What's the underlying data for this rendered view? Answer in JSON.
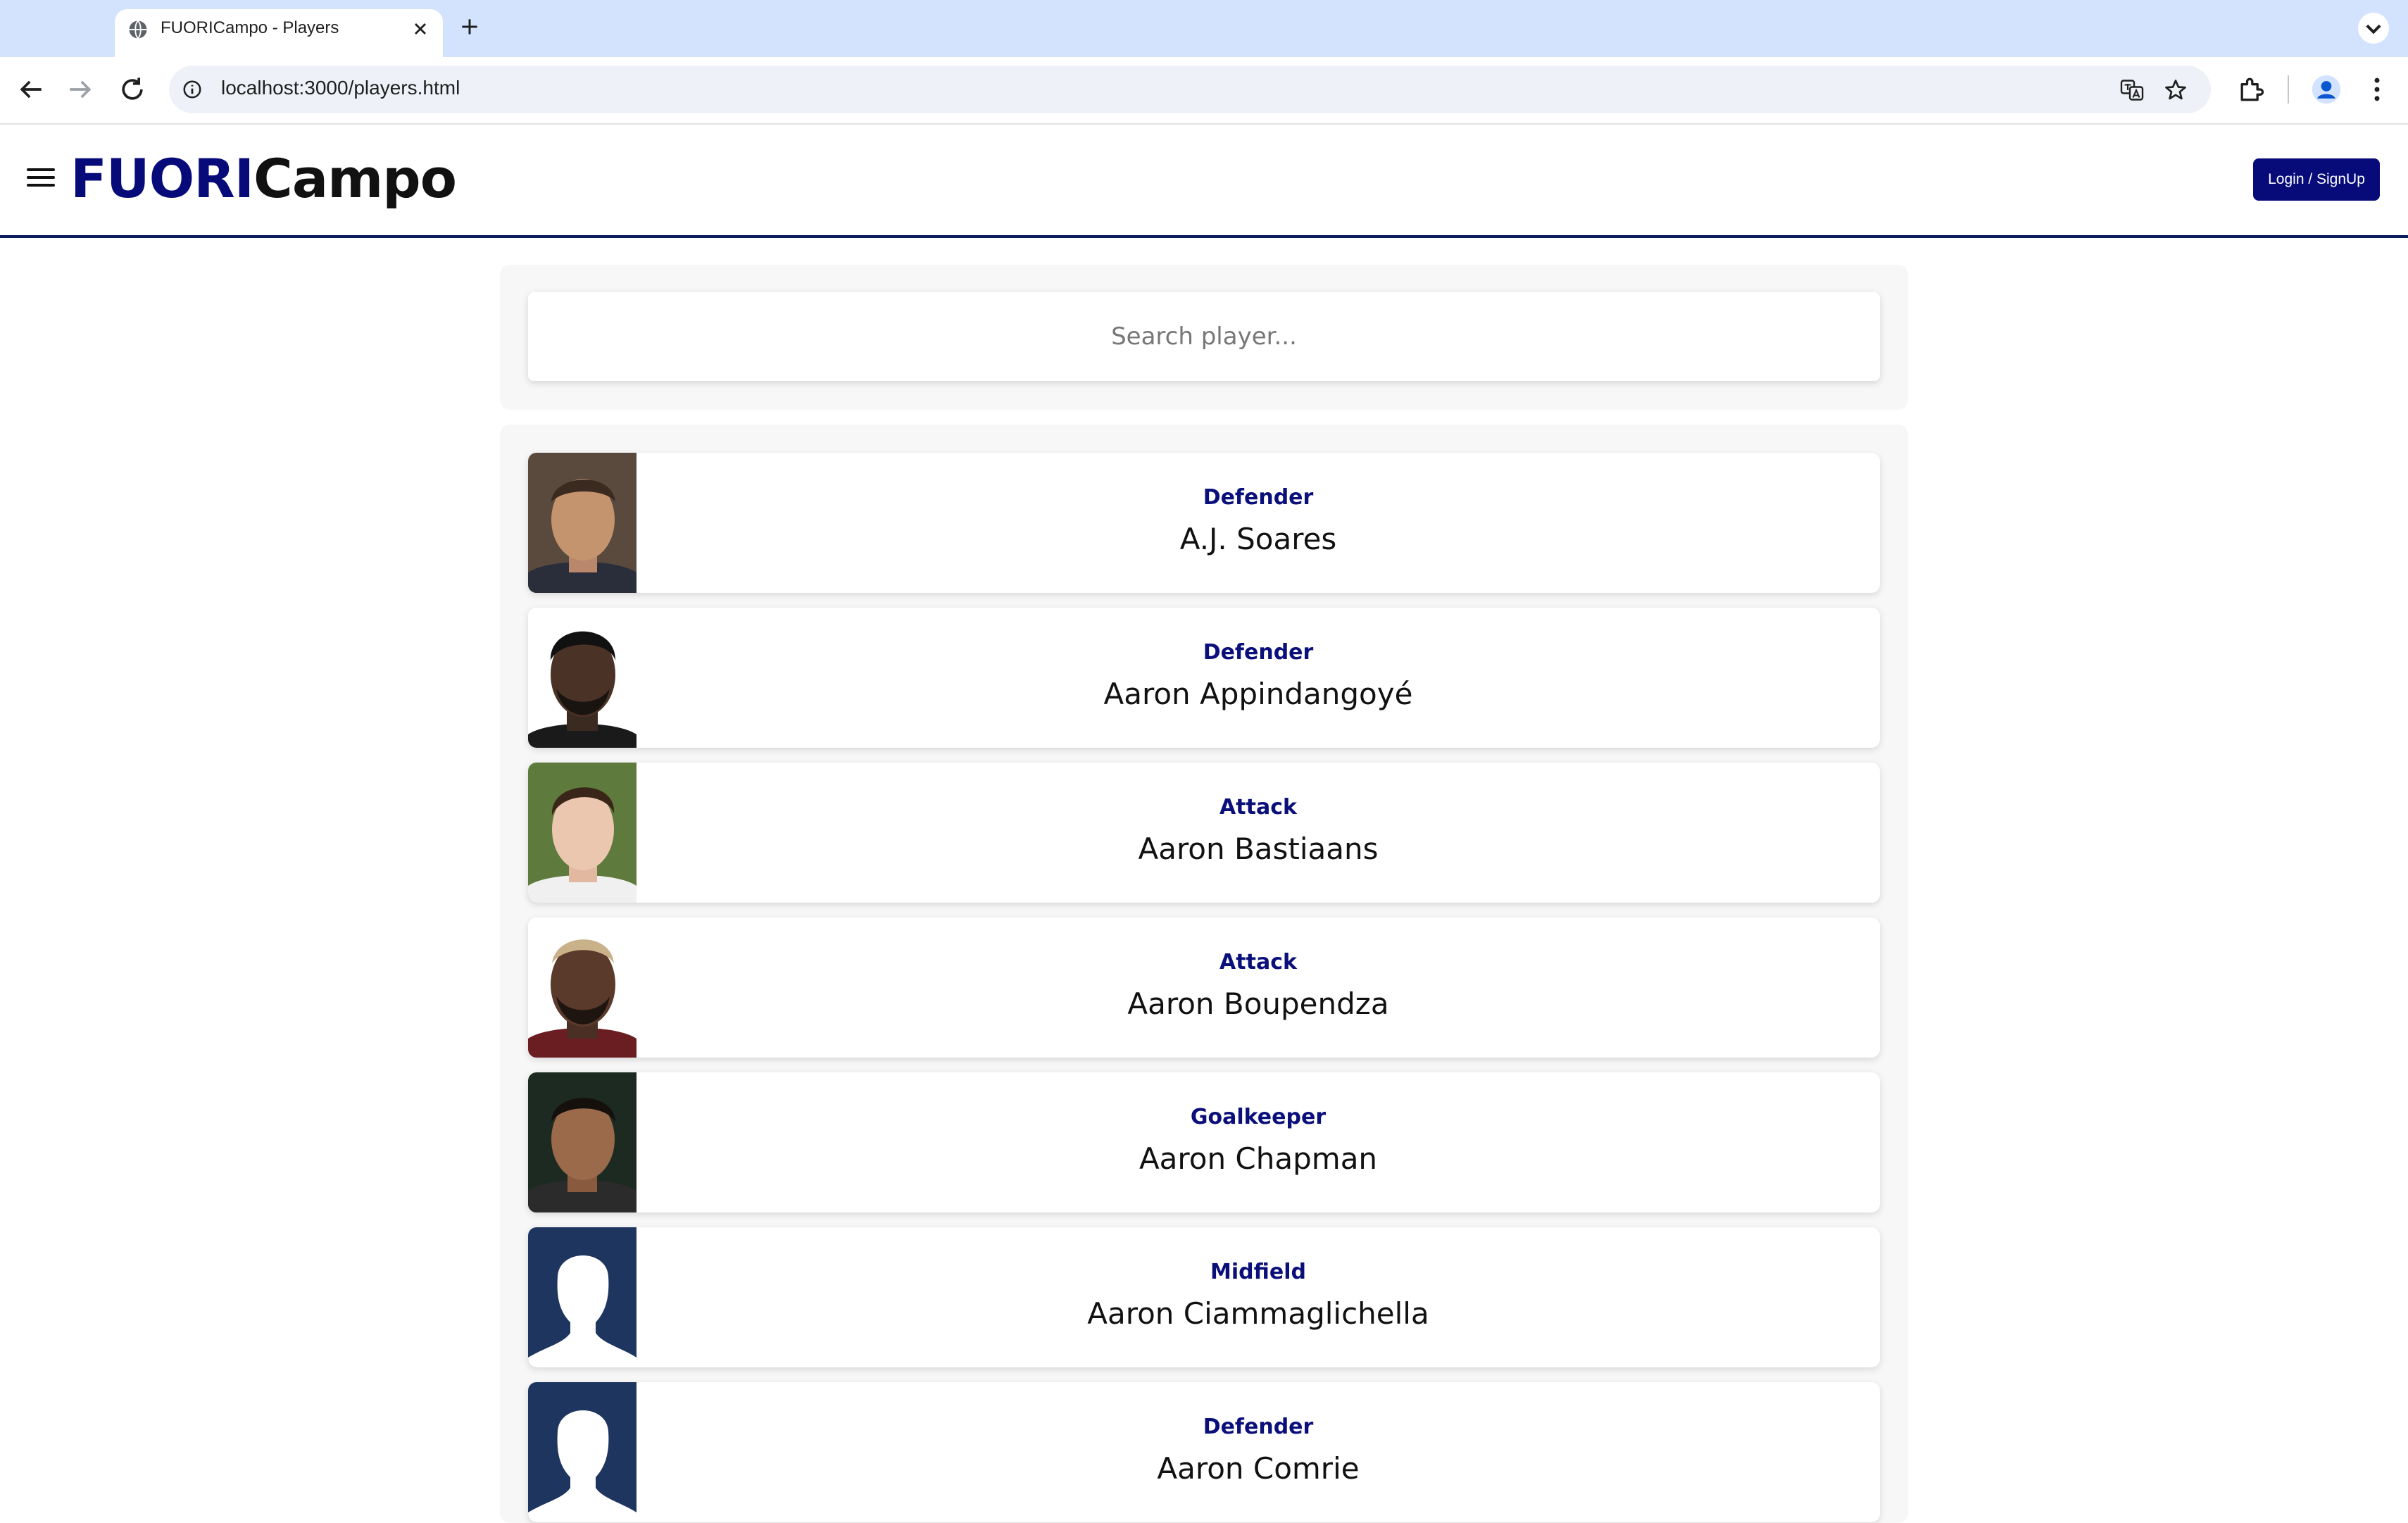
{
  "browser": {
    "tab_title": "FUORICampo - Players",
    "url": "localhost:3000/players.html"
  },
  "header": {
    "logo_part1": "FUORI",
    "logo_part2": "Campo",
    "login_label": "Login / SignUp"
  },
  "search": {
    "placeholder": "Search player..."
  },
  "players": [
    {
      "position": "Defender",
      "name": "A.J. Soares"
    },
    {
      "position": "Defender",
      "name": "Aaron Appindangoyé"
    },
    {
      "position": "Attack",
      "name": "Aaron Bastiaans"
    },
    {
      "position": "Attack",
      "name": "Aaron Boupendza"
    },
    {
      "position": "Goalkeeper",
      "name": "Aaron Chapman"
    },
    {
      "position": "Midfield",
      "name": "Aaron Ciammaglichella"
    },
    {
      "position": "Defender",
      "name": "Aaron Comrie"
    }
  ],
  "colors": {
    "brand_navy": "#070b7a",
    "position_text": "#0a0f7a",
    "placeholder_avatar_bg": "#1e3560"
  }
}
